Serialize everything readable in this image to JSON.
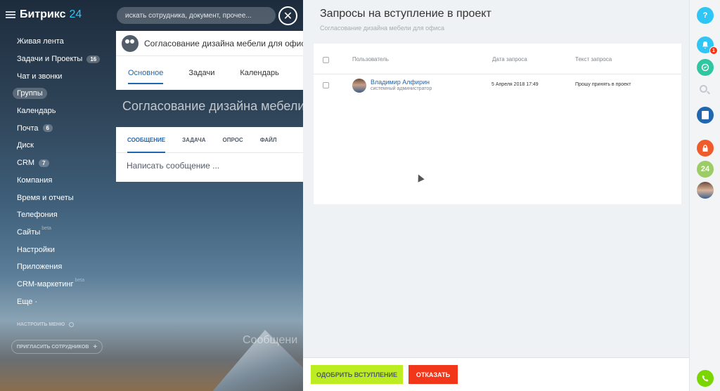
{
  "app": {
    "logo_main": "Битрикс",
    "logo_num": "24"
  },
  "search": {
    "placeholder": "искать сотрудника, документ, прочее..."
  },
  "sidebar": {
    "items": [
      {
        "label": "Живая лента"
      },
      {
        "label": "Задачи и Проекты",
        "count": "16"
      },
      {
        "label": "Чат и звонки"
      },
      {
        "label": "Группы",
        "active": true
      },
      {
        "label": "Календарь"
      },
      {
        "label": "Почта",
        "count": "6"
      },
      {
        "label": "Диск"
      },
      {
        "label": "CRM",
        "count": "7"
      },
      {
        "label": "Компания"
      },
      {
        "label": "Время и отчеты"
      },
      {
        "label": "Телефония"
      },
      {
        "label": "Сайты",
        "sup": "beta"
      },
      {
        "label": "Настройки"
      },
      {
        "label": "Приложения"
      },
      {
        "label": "CRM-маркетинг",
        "sup": "beta"
      },
      {
        "label": "Еще ·"
      }
    ],
    "configure": "НАСТРОИТЬ МЕНЮ",
    "invite": "ПРИГЛАСИТЬ СОТРУДНИКОВ",
    "invite_plus": "+"
  },
  "group": {
    "name": "Согласование дизайна мебели для офиса",
    "tabs": [
      "Основное",
      "Задачи",
      "Календарь"
    ],
    "title": "Согласование дизайна мебели для офиса",
    "post_tabs": [
      "СООБЩЕНИЕ",
      "ЗАДАЧА",
      "ОПРОС",
      "ФАЙЛ"
    ],
    "post_placeholder": "Написать сообщение ...",
    "bg_message": "Сообщени"
  },
  "close_label": "✕",
  "panel": {
    "title": "Запросы на вступление в проект",
    "subtitle": "Согласование дизайна мебели для офиса",
    "columns": {
      "user": "Пользователь",
      "date": "Дата запроса",
      "text": "Текст запроса"
    },
    "rows": [
      {
        "name": "Владимир Алфирин",
        "position": "системный администратор",
        "date": "5 Апреля 2018 17:49",
        "text": "Прошу принять в проект"
      }
    ],
    "approve": "ОДОБРИТЬ ВСТУПЛЕНИЕ",
    "reject": "ОТКАЗАТЬ"
  },
  "rightbar": {
    "help": "?",
    "notify_count": "1",
    "b24": "24",
    "colors": {
      "help": "#2fc6f6",
      "bell": "#2fc6f6",
      "chat": "#2fc6a0",
      "doc": "#2067b0",
      "lock": "#ef5b2b",
      "b24": "#9ccc65",
      "phone": "#7bd500"
    }
  },
  "colors": {
    "accent": "#2067b0",
    "approve": "#bbed21",
    "reject": "#f1361a",
    "logo_num": "#2fc6f6"
  }
}
